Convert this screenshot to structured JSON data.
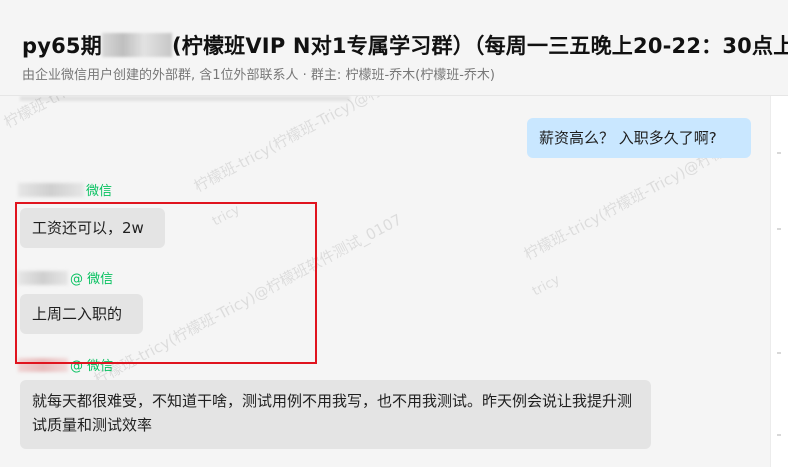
{
  "header": {
    "title_prefix": "py65期",
    "title_suffix": "(柠檬班VIP N对1专属学习群）（每周一三五晚上20-22：30点上",
    "subtitle": "由企业微信用户创建的外部群, 含1位外部联系人 · 群主: 柠檬班-乔木(柠檬班-乔木)"
  },
  "messages": [
    {
      "side": "self",
      "text": "薪资高么？ 入职多久了啊?"
    },
    {
      "side": "other",
      "sender_suffix": "微信",
      "text": "工资还可以，2w"
    },
    {
      "side": "other",
      "sender_suffix": "@ 微信",
      "text": "上周二入职的"
    },
    {
      "side": "other",
      "sender_suffix": "@ 微信",
      "text": "就每天都很难受，不知道干啥，测试用例不用我写，也不用我测试。昨天例会说让我提升测试质量和测试效率"
    }
  ],
  "watermarks": [
    "柠檬班-tricy(柠檬班-Tricy)@柠檬班软件测试_0107",
    "tricy",
    "柠檬班-tricy(柠檬班-Tricy)@柠檬班",
    "柠檬班-tricy(柠檬班-Tricy)@柠檬班软件测试_0107",
    "tricy",
    "柠檬班-tricy(柠檬班-Tricy)@柠檬班"
  ],
  "colors": {
    "self_bubble": "#c9e7ff",
    "other_bubble": "#e4e4e4",
    "sender_name": "#07c160",
    "highlight_box": "#e0141e"
  }
}
